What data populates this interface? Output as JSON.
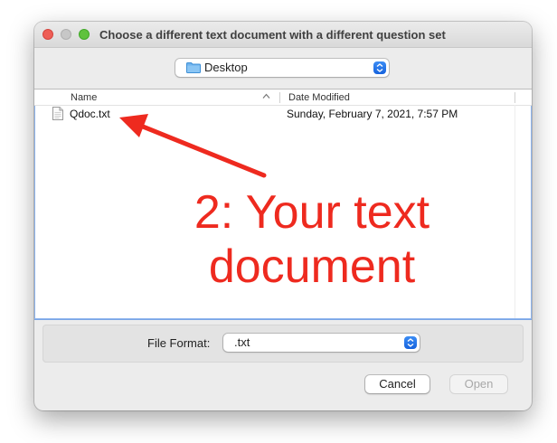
{
  "window": {
    "title": "Choose a different text document with a different question set"
  },
  "location": {
    "selected": "Desktop",
    "icon": "folder-icon"
  },
  "list": {
    "columns": {
      "name": "Name",
      "date_modified": "Date Modified"
    },
    "sort": "name-ascending",
    "rows": [
      {
        "name": "Qdoc.txt",
        "date_modified": "Sunday, February 7, 2021, 7:57 PM",
        "icon": "text-document-icon"
      }
    ]
  },
  "accessory": {
    "format_label": "File Format:",
    "format_value": ".txt"
  },
  "buttons": {
    "cancel": "Cancel",
    "open": "Open"
  },
  "annotation": {
    "line1": "2: Your text",
    "line2": "document",
    "color": "#ee2a1f"
  },
  "colors": {
    "accent": "#1662dd",
    "window_bg": "#ececec"
  }
}
